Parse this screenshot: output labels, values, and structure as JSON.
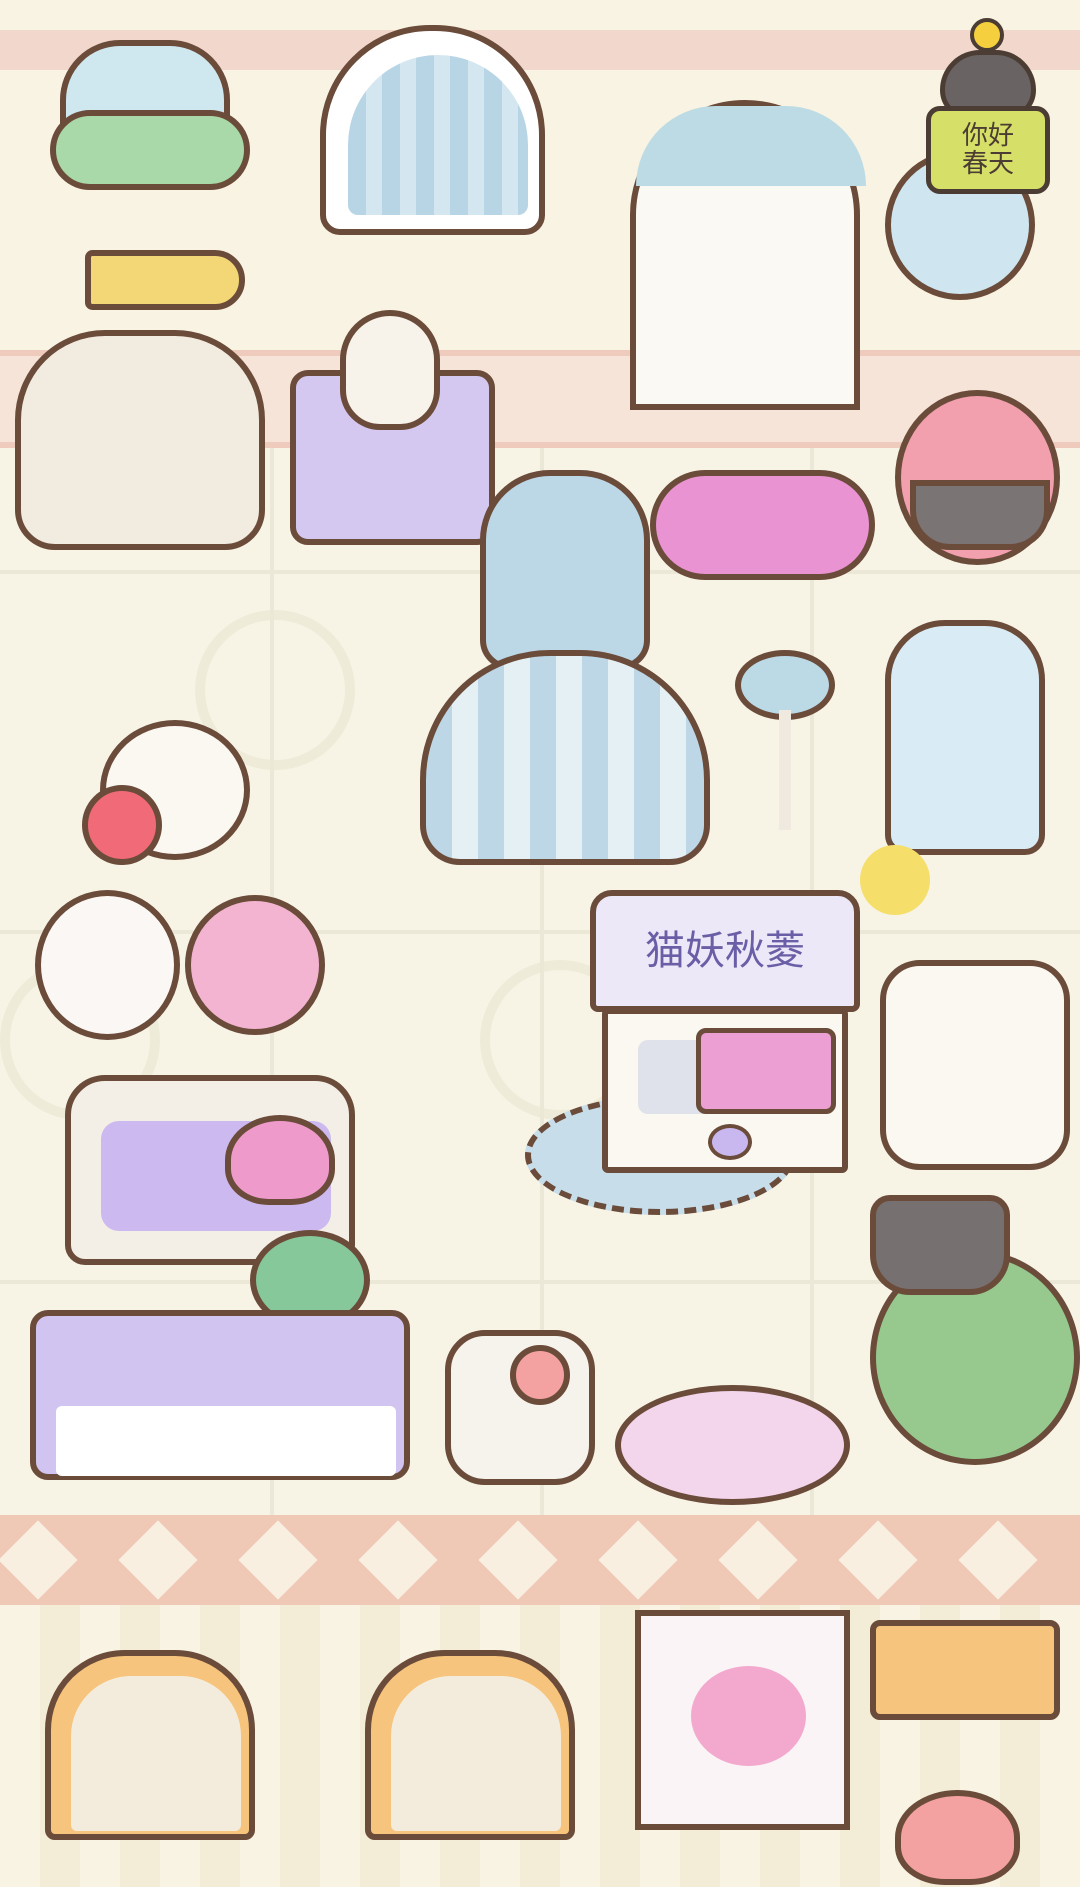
{
  "room": {
    "greeting_sign": {
      "line1": "你好",
      "line2": "春天"
    },
    "machine_label": "猫妖秋菱"
  },
  "colors": {
    "wall": "#f8f3e2",
    "trim": "#f2d8cc",
    "outline": "#6b4b3a",
    "lilac": "#d2c4f1",
    "pink": "#ee9bcc",
    "sky": "#bcd7e6",
    "sign_green": "#d6df67"
  },
  "icons": {
    "cat": "cat-icon",
    "heart": "heart-icon",
    "flower": "flower-icon"
  }
}
